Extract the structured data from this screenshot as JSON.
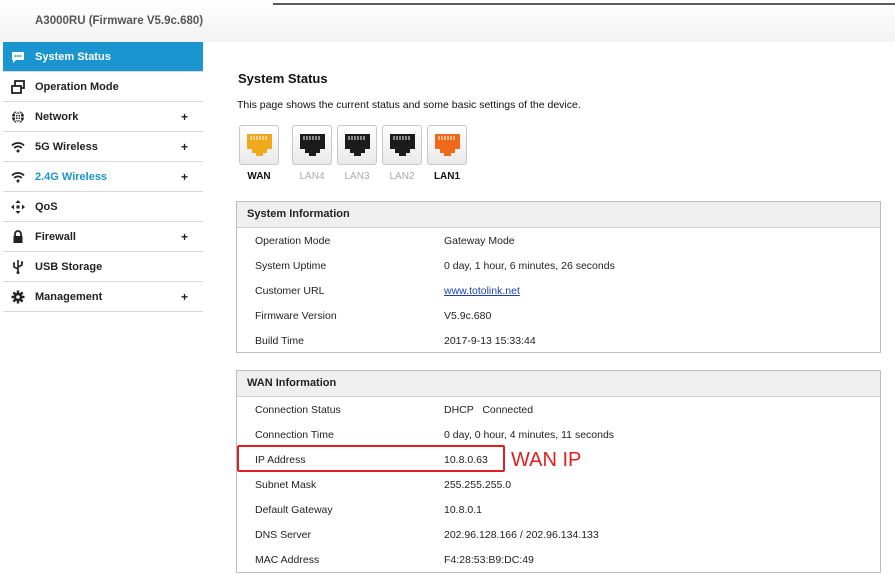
{
  "header": {
    "title": "A3000RU (Firmware V5.9c.680)"
  },
  "sidebar": {
    "items": [
      {
        "label": "System Status",
        "icon": "chat-icon",
        "expandable": false
      },
      {
        "label": "Operation Mode",
        "icon": "windows-icon",
        "expandable": false
      },
      {
        "label": "Network",
        "icon": "globe-icon",
        "expandable": true
      },
      {
        "label": "5G Wireless",
        "icon": "wifi-icon",
        "expandable": true
      },
      {
        "label": "2.4G Wireless",
        "icon": "wifi-icon",
        "expandable": true
      },
      {
        "label": "QoS",
        "icon": "arrows-icon",
        "expandable": false
      },
      {
        "label": "Firewall",
        "icon": "lock-icon",
        "expandable": true
      },
      {
        "label": "USB Storage",
        "icon": "usb-icon",
        "expandable": false
      },
      {
        "label": "Management",
        "icon": "gear-icon",
        "expandable": true
      }
    ],
    "plus": "+"
  },
  "page": {
    "title": "System Status",
    "description": "This page shows the current status and some basic settings of the device."
  },
  "ports": [
    {
      "label": "WAN",
      "color": "#f0a91c",
      "active": true
    },
    {
      "label": "LAN4",
      "color": "#1b1b1b",
      "active": false
    },
    {
      "label": "LAN3",
      "color": "#1b1b1b",
      "active": false
    },
    {
      "label": "LAN2",
      "color": "#1b1b1b",
      "active": false
    },
    {
      "label": "LAN1",
      "color": "#ee6a1a",
      "active": true
    }
  ],
  "system_info": {
    "heading": "System Information",
    "rows": [
      {
        "key": "Operation Mode",
        "value": "Gateway Mode"
      },
      {
        "key": "System Uptime",
        "value": "0 day, 1 hour, 6 minutes, 26 seconds"
      },
      {
        "key": "Customer URL",
        "value": "www.totolink.net"
      },
      {
        "key": "Firmware Version",
        "value": "V5.9c.680"
      },
      {
        "key": "Build Time",
        "value": "2017-9-13 15:33:44"
      }
    ]
  },
  "wan_info": {
    "heading": "WAN Information",
    "rows": [
      {
        "key": "Connection Status",
        "value": "DHCP   Connected"
      },
      {
        "key": "Connection Time",
        "value": "0 day, 0 hour, 4 minutes, 11 seconds"
      },
      {
        "key": "IP Address",
        "value": "10.8.0.63"
      },
      {
        "key": "Subnet Mask",
        "value": "255.255.255.0"
      },
      {
        "key": "Default Gateway",
        "value": "10.8.0.1"
      },
      {
        "key": "DNS Server",
        "value": "202.96.128.166 / 202.96.134.133"
      },
      {
        "key": "MAC Address",
        "value": "F4:28:53:B9:DC:49"
      }
    ]
  },
  "annotation": {
    "text": "WAN IP",
    "color": "#e02020"
  },
  "colors": {
    "accent": "#1a95d0",
    "link": "#1a3fb3"
  }
}
